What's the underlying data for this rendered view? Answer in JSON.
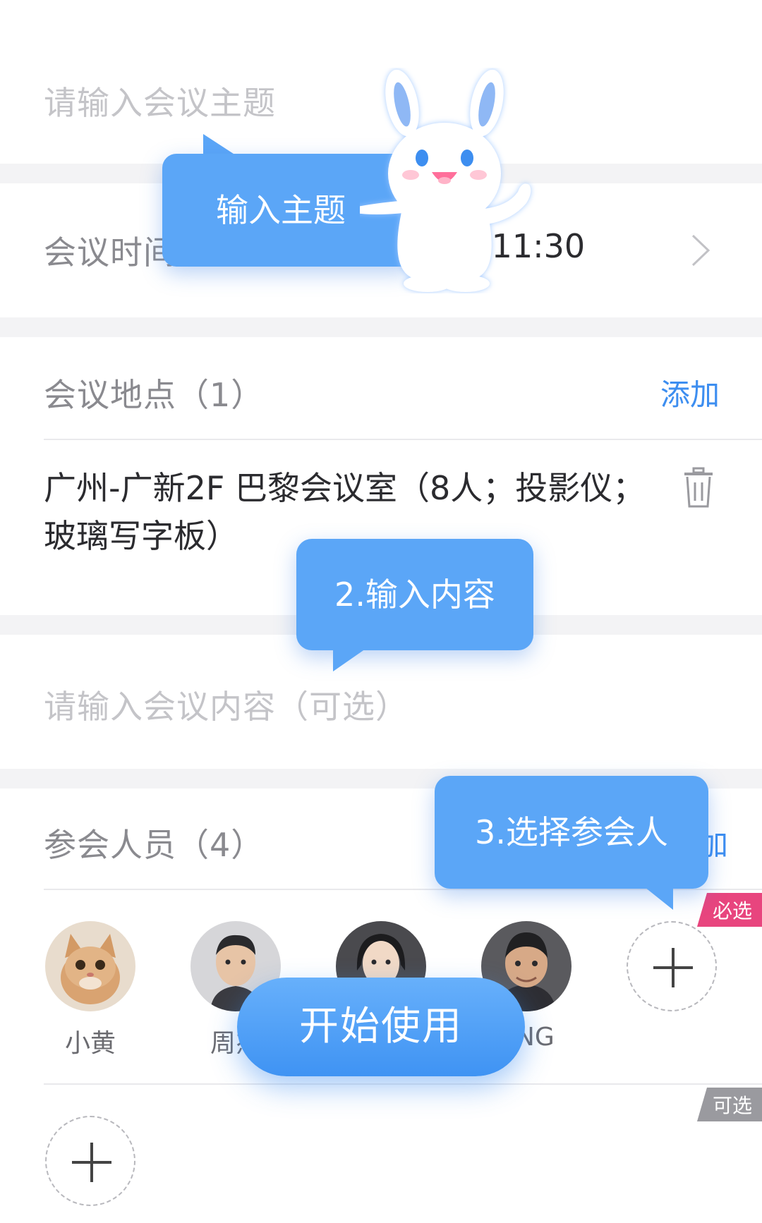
{
  "topic": {
    "placeholder": "请输入会议主题"
  },
  "time": {
    "label": "会议时间",
    "value": "-11:30"
  },
  "location": {
    "label": "会议地点（1）",
    "add_label": "添加",
    "room": "广州-广新2F 巴黎会议室（8人；投影仪；玻璃写字板）"
  },
  "content": {
    "placeholder": "请输入会议内容（可选）"
  },
  "attendees": {
    "label": "参会人员（4）",
    "add_label_partial": "加",
    "required_tag": "必选",
    "optional_tag": "可选",
    "people": [
      {
        "name": "小黄"
      },
      {
        "name": "周杰"
      },
      {
        "name": ""
      },
      {
        "name": "ANG"
      }
    ]
  },
  "guide": {
    "step1": "输入主题",
    "step2": "2.输入内容",
    "step3": "3.选择参会人",
    "start_button": "开始使用"
  },
  "colors": {
    "accent": "#3d8ef0",
    "bubble": "#5ba6f7",
    "required_tag": "#e8457e",
    "optional_tag": "#9a9a9f"
  }
}
